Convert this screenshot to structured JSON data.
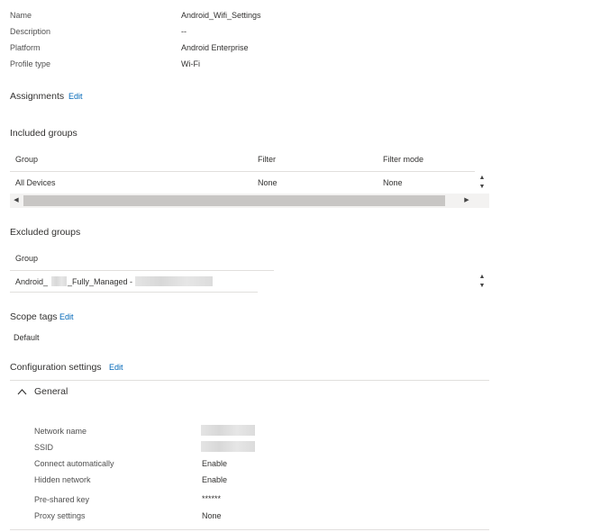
{
  "basics": {
    "rows": [
      {
        "label": "Name",
        "value": "Android_Wifi_Settings"
      },
      {
        "label": "Description",
        "value": "--"
      },
      {
        "label": "Platform",
        "value": "Android Enterprise"
      },
      {
        "label": "Profile type",
        "value": "Wi-Fi"
      }
    ]
  },
  "assignments": {
    "title": "Assignments",
    "edit_label": "Edit",
    "included": {
      "title": "Included groups",
      "columns": [
        "Group",
        "Filter",
        "Filter mode"
      ],
      "rows": [
        [
          "All Devices",
          "None",
          "None"
        ]
      ]
    },
    "excluded": {
      "title": "Excluded groups",
      "columns": [
        "Group"
      ],
      "rows": [
        {
          "prefix": "Android_",
          "middle": "_Fully_Managed -"
        }
      ]
    }
  },
  "scope_tags": {
    "title": "Scope tags",
    "edit_label": "Edit",
    "value": "Default"
  },
  "configuration": {
    "title": "Configuration settings",
    "edit_label": "Edit",
    "group_label": "General",
    "settings": [
      {
        "label": "Network name",
        "value": ""
      },
      {
        "label": "SSID",
        "value": ""
      },
      {
        "label": "Connect automatically",
        "value": "Enable"
      },
      {
        "label": "Hidden network",
        "value": "Enable"
      },
      {
        "label": "Pre-shared key",
        "value": "******"
      },
      {
        "label": "Proxy settings",
        "value": "None"
      }
    ]
  },
  "icons": {
    "chevron_up": "chevron-up-icon",
    "scroll_up": "scroll-up-icon",
    "scroll_down": "scroll-down-icon",
    "scroll_left": "scroll-left-icon",
    "scroll_right": "scroll-right-icon"
  },
  "colors": {
    "link": "#0067b8",
    "divider": "#e1dfdd",
    "scrollbar_thumb": "#c8c6c4"
  }
}
